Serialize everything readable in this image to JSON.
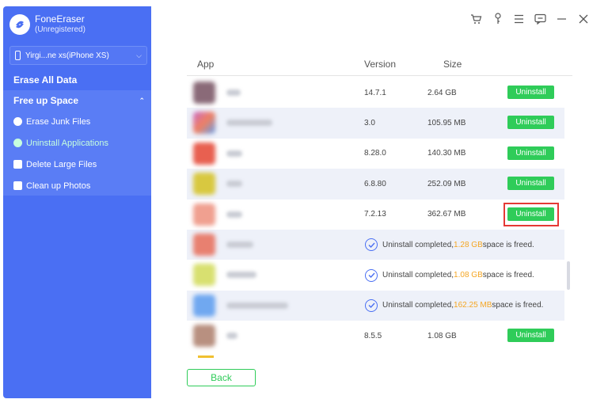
{
  "app": {
    "name": "FoneEraser",
    "status": "(Unregistered)"
  },
  "device": {
    "name": "Yirgi...ne xs(iPhone XS)"
  },
  "sidebar": {
    "erase_all": "Erase All Data",
    "free_up": {
      "label": "Free up Space",
      "items": [
        {
          "label": "Erase Junk Files",
          "icon": "clock-icon"
        },
        {
          "label": "Uninstall Applications",
          "icon": "apps-icon",
          "active": true
        },
        {
          "label": "Delete Large Files",
          "icon": "file-icon"
        },
        {
          "label": "Clean up Photos",
          "icon": "photo-icon"
        }
      ]
    }
  },
  "titlebar": {
    "icons": [
      "cart-icon",
      "key-icon",
      "menu-icon",
      "feedback-icon",
      "minimize-icon",
      "close-icon"
    ]
  },
  "table": {
    "headers": {
      "app": "App",
      "version": "Version",
      "size": "Size"
    },
    "rows": [
      {
        "version": "14.7.1",
        "size": "2.64 GB",
        "action": "Uninstall",
        "thumb": "#8a6a78"
      },
      {
        "version": "3.0",
        "size": "105.95 MB",
        "action": "Uninstall",
        "thumb": "#c86ac8"
      },
      {
        "version": "8.28.0",
        "size": "140.30 MB",
        "action": "Uninstall",
        "thumb": "#e86050"
      },
      {
        "version": "6.8.80",
        "size": "252.09 MB",
        "action": "Uninstall",
        "thumb": "#d8c840"
      },
      {
        "version": "7.2.13",
        "size": "362.67 MB",
        "action": "Uninstall",
        "thumb": "#f0a090",
        "highlight": true
      },
      {
        "done_prefix": "Uninstall completed, ",
        "freed": "1.28 GB",
        "done_suffix": " space is freed.",
        "thumb": "#e88070"
      },
      {
        "done_prefix": "Uninstall completed, ",
        "freed": "1.08 GB",
        "done_suffix": " space is freed.",
        "thumb": "#d8e070"
      },
      {
        "done_prefix": "Uninstall completed, ",
        "freed": "162.25 MB",
        "done_suffix": " space is freed.",
        "thumb": "#70a8f0"
      },
      {
        "version": "8.5.5",
        "size": "1.08 GB",
        "action": "Uninstall",
        "thumb": "#b89080"
      }
    ]
  },
  "footer": {
    "back": "Back"
  },
  "colors": {
    "sidebar": "#4a6ff3",
    "accent_green": "#2fcc59",
    "freed_orange": "#f5a623",
    "highlight_red": "#e53935"
  }
}
